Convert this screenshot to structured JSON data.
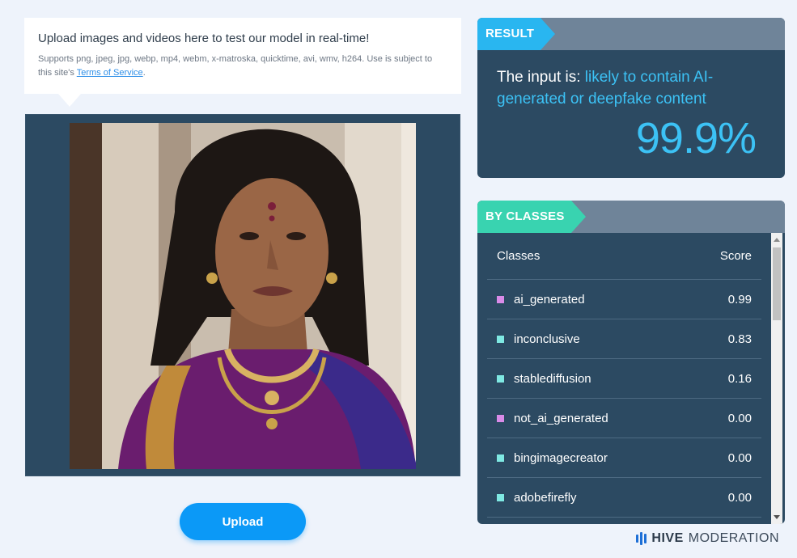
{
  "upload_info": {
    "title": "Upload images and videos here to test our model in real-time!",
    "subtitle": "Supports png, jpeg, jpg, webp, mp4, webm, x-matroska, quicktime, avi, wmv, h264. Use is subject to this site's",
    "terms_link": "Terms of Service",
    "terms_suffix": "."
  },
  "upload_button": {
    "label": "Upload"
  },
  "result": {
    "tag": "RESULT",
    "prefix": "The input is:",
    "verdict": "likely to contain AI-generated or deepfake content",
    "score": "99.9%"
  },
  "by_classes": {
    "tag": "BY CLASSES",
    "header_class": "Classes",
    "header_score": "Score",
    "rows": [
      {
        "name": "ai_generated",
        "score": "0.99",
        "color": "#d98be8"
      },
      {
        "name": "inconclusive",
        "score": "0.83",
        "color": "#7fe9e3"
      },
      {
        "name": "stablediffusion",
        "score": "0.16",
        "color": "#7fe9e3"
      },
      {
        "name": "not_ai_generated",
        "score": "0.00",
        "color": "#d98be8"
      },
      {
        "name": "bingimagecreator",
        "score": "0.00",
        "color": "#7fe9e3"
      },
      {
        "name": "adobefirefly",
        "score": "0.00",
        "color": "#7fe9e3"
      }
    ]
  },
  "brand": {
    "name": "HIVE",
    "suffix": "MODERATION"
  },
  "colors": {
    "accent_blue": "#29b6f0",
    "accent_teal": "#39d3b0",
    "panel_bg": "#2c4a62",
    "button_blue": "#0b99f7"
  }
}
